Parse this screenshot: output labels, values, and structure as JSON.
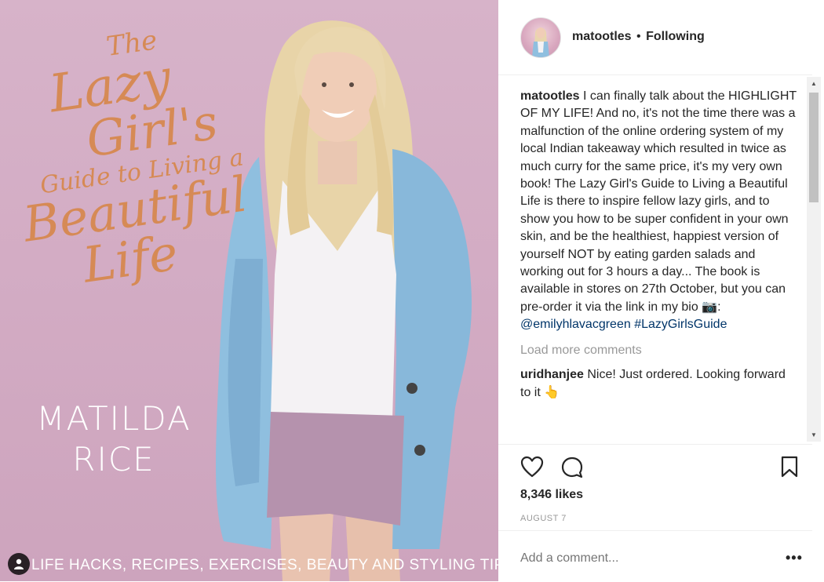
{
  "post": {
    "cover": {
      "title_lines": [
        "The",
        "Lazy",
        "Girl's",
        "Guide to Living a",
        "Beautiful",
        "Life"
      ],
      "author_lines": [
        "MATILDA",
        "RICE"
      ],
      "tagline": "LIFE HACKS, RECIPES, EXERCISES, BEAUTY AND STYLING TIPS"
    }
  },
  "header": {
    "username": "matootles",
    "separator": "•",
    "follow_status": "Following"
  },
  "caption": {
    "username": "matootles",
    "text": "I can finally talk about the HIGHLIGHT OF MY LIFE! And no, it's not the time there was a malfunction of the online ordering system of my local Indian takeaway which resulted in twice as much curry for the same price, it's my very own book! The Lazy Girl's Guide to Living a Beautiful Life is there to inspire fellow lazy girls, and to show you how to be super confident in your own skin, and be the healthiest, happiest version of yourself NOT by eating garden salads and working out for 3 hours a day... The book is available in stores on 27th October, but you can pre-order it via the link in my bio",
    "emoji_1": "📷:",
    "mention": "@emilyhlavacgreen",
    "hashtag": "#LazyGirlsGuide"
  },
  "load_more": "Load more comments",
  "comments": [
    {
      "username": "uridhanjee",
      "text": "Nice! Just ordered. Looking forward to it",
      "emoji": "👆"
    }
  ],
  "stats": {
    "likes": "8,346 likes",
    "date": "AUGUST 7"
  },
  "add_comment": {
    "placeholder": "Add a comment...",
    "more": "•••"
  },
  "icons": [
    "heart-icon",
    "comment-icon",
    "bookmark-icon",
    "tagged-user-icon",
    "scroll-up-arrow",
    "scroll-down-arrow"
  ]
}
